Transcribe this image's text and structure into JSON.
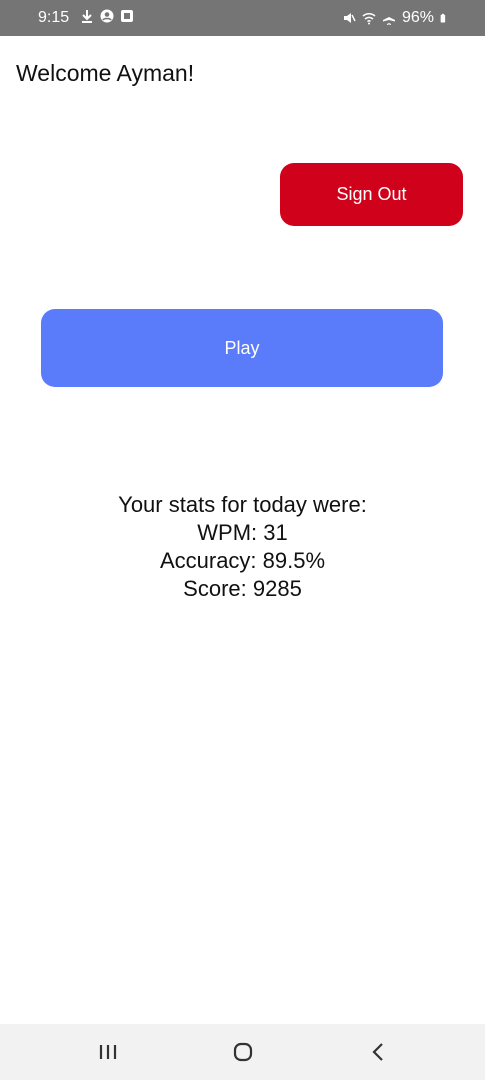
{
  "status_bar": {
    "time": "9:15",
    "battery": "96%",
    "left_icons": [
      "download-icon",
      "account-icon",
      "screenshot-icon"
    ],
    "right_icons": [
      "mute-icon",
      "wifi-icon",
      "airplane-icon",
      "battery-icon"
    ]
  },
  "greeting": "Welcome Ayman!",
  "buttons": {
    "sign_out": "Sign Out",
    "play": "Play"
  },
  "stats": {
    "heading": "Your stats for today were:",
    "wpm": "WPM: 31",
    "accuracy": "Accuracy: 89.5%",
    "score": "Score: 9285"
  },
  "nav": {
    "items": [
      "recent-apps-icon",
      "home-icon",
      "back-icon"
    ]
  },
  "colors": {
    "sign_out": "#d0021b",
    "play": "#5b7cfa",
    "status_bar": "#757575"
  }
}
